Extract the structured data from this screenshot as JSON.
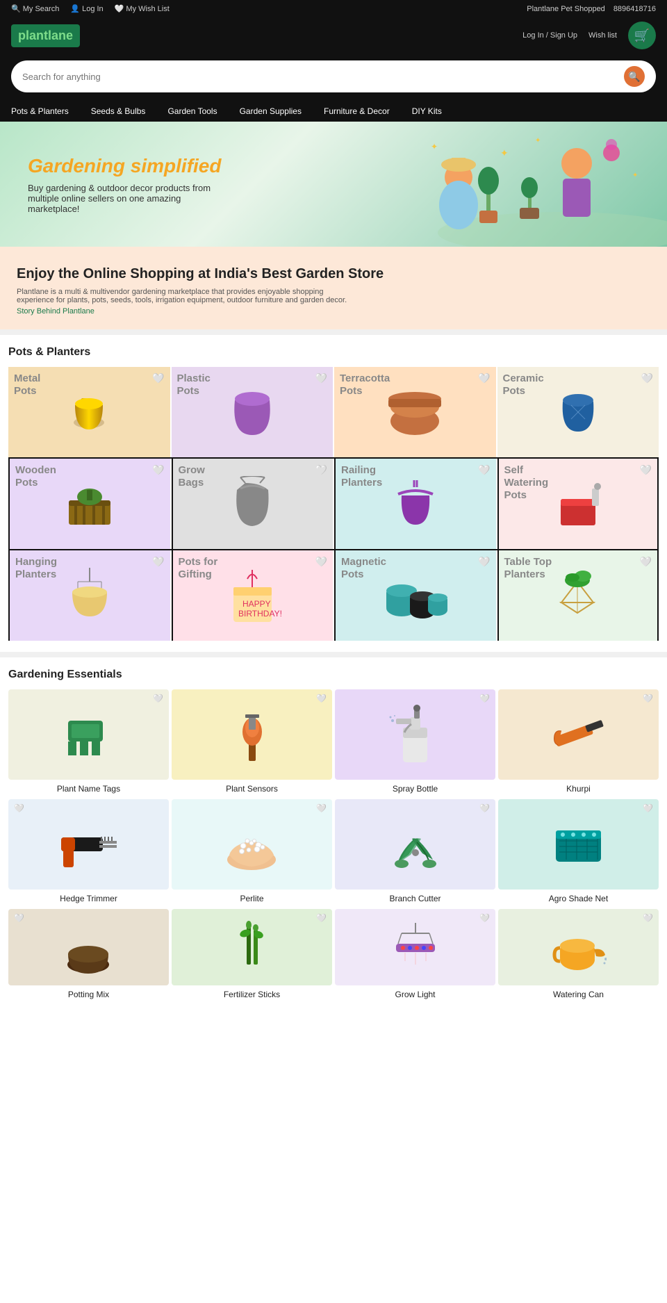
{
  "topbar": {
    "left": [
      {
        "label": "My Search",
        "icon": "🔍"
      },
      {
        "label": "Log In",
        "icon": "👤"
      },
      {
        "label": "My Wish List",
        "icon": "🤍"
      }
    ],
    "right": {
      "store_name": "Plantlane Pet Shopped",
      "phone": "8896418716"
    }
  },
  "header": {
    "logo": "plantlane",
    "search_placeholder": "Search for anything",
    "links": [
      "Log In / Sign Up",
      "Wish list"
    ],
    "cart_label": "Cart"
  },
  "nav": {
    "items": [
      "Pots & Planters",
      "Seeds & Bulbs",
      "Garden Tools",
      "Garden Supplies",
      "Furniture & Decor",
      "DIY Kits"
    ]
  },
  "hero": {
    "heading_normal": "Gardening",
    "heading_styled": "simplified",
    "subtext": "Buy gardening & outdoor decor products from multiple online sellers on one amazing marketplace!"
  },
  "about": {
    "heading": "Enjoy the Online Shopping at India's Best Garden Store",
    "description": "Plantlane is a multi & multivendor gardening marketplace that provides enjoyable shopping experience for plants, pots, seeds, tools, irrigation equipment, outdoor furniture and garden decor.",
    "link": "Story Behind Plantlane"
  },
  "pots_section": {
    "title": "Pots & Planters",
    "items": [
      {
        "label": "Metal Pots",
        "bg": "#f5deb3",
        "emoji": "🪴"
      },
      {
        "label": "Plastic Pots",
        "bg": "#e8d8f0",
        "emoji": "🪣"
      },
      {
        "label": "Terracotta Pots",
        "bg": "#ffe0c0",
        "emoji": "🏺"
      },
      {
        "label": "Ceramic Pots",
        "bg": "#f5f0e0",
        "emoji": "🫙"
      },
      {
        "label": "Wooden Pots",
        "bg": "#e8d8f8",
        "emoji": "🌿"
      },
      {
        "label": "Grow Bags",
        "bg": "#e0e0e0",
        "emoji": "👜"
      },
      {
        "label": "Railing Planters",
        "bg": "#d0eeee",
        "emoji": "🪴"
      },
      {
        "label": "Self Watering Pots",
        "bg": "#fce8e8",
        "emoji": "💧"
      },
      {
        "label": "Hanging Planters",
        "bg": "#e8d8f8",
        "emoji": "🌸"
      },
      {
        "label": "Pots for Gifting",
        "bg": "#ffe0e8",
        "emoji": "🎁"
      },
      {
        "label": "Magnetic Pots",
        "bg": "#d0eeee",
        "emoji": "🧲"
      },
      {
        "label": "Table Top Planters",
        "bg": "#e8f5e8",
        "emoji": "🌱"
      }
    ]
  },
  "essentials_section": {
    "title": "Gardening Essentials",
    "rows": [
      [
        {
          "label": "Plant Name Tags",
          "bg": "#f0f0e0",
          "emoji": "🏷️"
        },
        {
          "label": "Plant Sensors",
          "bg": "#f8f0c0",
          "emoji": "📡"
        },
        {
          "label": "Spray Bottle",
          "bg": "#e8d8f8",
          "emoji": "🫧"
        },
        {
          "label": "Khurpi",
          "bg": "#f5e8d0",
          "emoji": "🔧"
        }
      ],
      [
        {
          "label": "Hedge Trimmer",
          "bg": "#e8f0f8",
          "emoji": "✂️"
        },
        {
          "label": "Perlite",
          "bg": "#e8f8f8",
          "emoji": "🪨"
        },
        {
          "label": "Branch Cutter",
          "bg": "#e8e8f8",
          "emoji": "🌿"
        },
        {
          "label": "Agro Shade Net",
          "bg": "#d0eee8",
          "emoji": "🕸️"
        }
      ],
      [
        {
          "label": "Potting Mix",
          "bg": "#e8e0d0",
          "emoji": "🌱"
        },
        {
          "label": "Fertilizer Sticks",
          "bg": "#e0f0d8",
          "emoji": "🌿"
        },
        {
          "label": "Grow Light",
          "bg": "#f0e8f8",
          "emoji": "💡"
        },
        {
          "label": "Watering Can",
          "bg": "#e8f0e0",
          "emoji": "🚿"
        }
      ]
    ]
  }
}
